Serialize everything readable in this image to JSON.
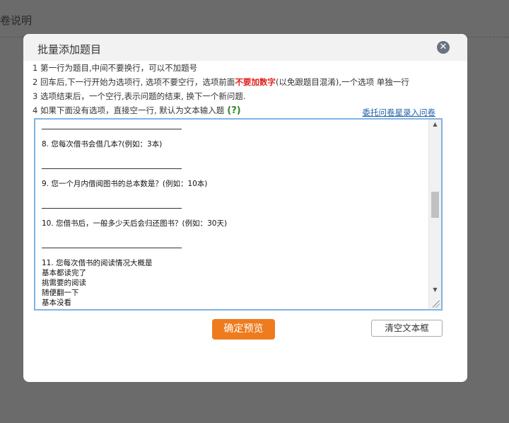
{
  "background": {
    "section_text": "卷说明"
  },
  "modal": {
    "title": "批量添加题目",
    "close_icon": "close-icon",
    "instructions": {
      "line1": "1 第一行为题目,中间不要换行，可以不加题号",
      "line2_before": "2 回车后,下一行开始为选项行, 选项不要空行，选项前面",
      "line2_highlight": "不要加数字",
      "line2_after": "(以免跟题目混淆),一个选项 单独一行",
      "line3": "3 选项结束后，一个空行,表示问题的结束, 换下一个新问题.",
      "line4": "4 如果下面没有选项，直接空一行, 默认为文本输入题",
      "help_mark": "(?)"
    },
    "link_label": "委托问卷星录入问卷",
    "textarea_lines": [
      {
        "kind": "rule"
      },
      {
        "kind": "blank"
      },
      {
        "kind": "text",
        "text": "8.  您每次借书会借几本?(例如：3本)"
      },
      {
        "kind": "blank"
      },
      {
        "kind": "rule"
      },
      {
        "kind": "blank"
      },
      {
        "kind": "text",
        "text": "9.  您一个月内借阅图书的总本数是？(例如：10本)"
      },
      {
        "kind": "blank"
      },
      {
        "kind": "rule"
      },
      {
        "kind": "blank"
      },
      {
        "kind": "text",
        "text": "10.  您借书后，一般多少天后会归还图书？(例如：30天)"
      },
      {
        "kind": "blank"
      },
      {
        "kind": "rule"
      },
      {
        "kind": "blank"
      },
      {
        "kind": "text",
        "text": "11.  您每次借书的阅读情况大概是"
      },
      {
        "kind": "text",
        "text": "基本都读完了"
      },
      {
        "kind": "text",
        "text": "挑需要的阅读"
      },
      {
        "kind": "text",
        "text": "随便翻一下"
      },
      {
        "kind": "text",
        "text": "基本没看"
      }
    ],
    "confirm_button": "确定预览",
    "clear_button": "清空文本框"
  },
  "colors": {
    "overlay": "#6b6b6b",
    "confirm_button": "#ee7b1e",
    "highlight_red": "#e0211c",
    "help_green": "#2e8b1f",
    "link_blue": "#1f5fa6",
    "textarea_border": "#7fb4e6"
  }
}
